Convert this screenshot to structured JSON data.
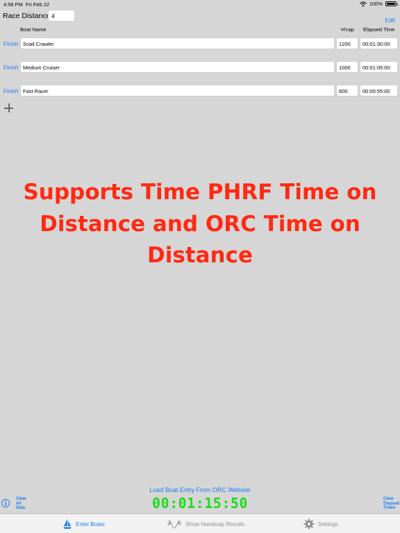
{
  "status_bar": {
    "time": "4:58 PM",
    "date": "Fri Feb 22",
    "battery": "100%"
  },
  "race": {
    "label": "Race Distance:",
    "distance": "4"
  },
  "edit_label": "Edit",
  "columns": {
    "boat_name": "Boat Name",
    "hcap": "H'cap",
    "elapsed": "Elapsed Time"
  },
  "boats": [
    {
      "finish": "Finish",
      "name": "Snail Crawler",
      "hcap": "1200",
      "elapsed": "00:01:30:00"
    },
    {
      "finish": "Finish",
      "name": "Medium Cruiser",
      "hcap": "1000",
      "elapsed": "00:01:05:00"
    },
    {
      "finish": "Finish",
      "name": "Fast Racer",
      "hcap": "600",
      "elapsed": "00:00:55:00"
    }
  ],
  "banner": "Supports Time PHRF Time on Distance and ORC Time on Distance",
  "load_orc": "Load Boat Entry From ORC Website",
  "clock": "00:01:15:50",
  "clear_all": "Clear All Data",
  "clear_elapsed": "Clear Elapsed Times",
  "tabs": {
    "boats": "Enter Boats",
    "results": "Show Handicap Results",
    "settings": "Settings"
  },
  "colors": {
    "accent": "#1b7cf0",
    "banner": "#ff2a14",
    "clock": "#1bdc1b",
    "background": "#d6d6d6"
  },
  "icons": {
    "wifi": "wifi-icon",
    "battery": "battery-icon",
    "add": "plus-icon",
    "info": "info-icon",
    "boats_tab": "sailboat-icon",
    "results_tab": "checkered-flags-icon",
    "settings_tab": "gear-icon"
  }
}
